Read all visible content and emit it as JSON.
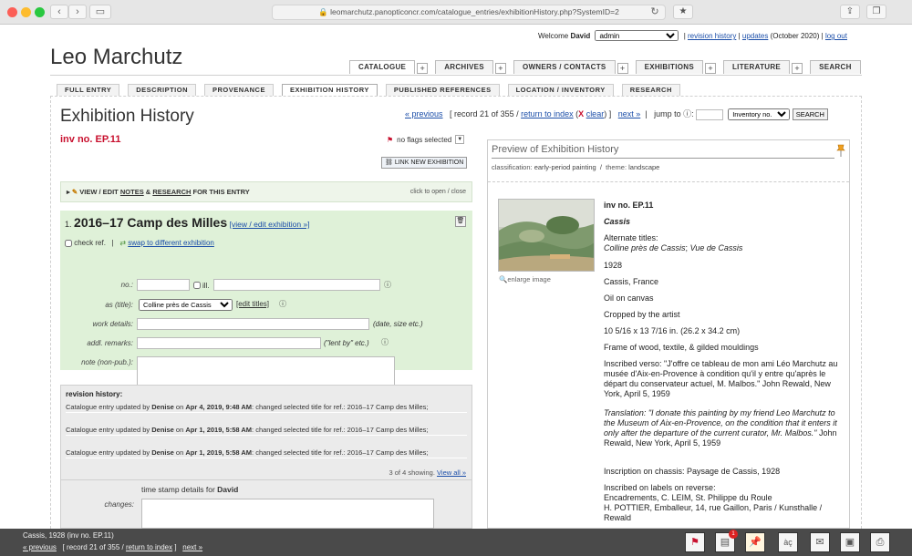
{
  "browser": {
    "url": "leomarchutz.panopticoncr.com/catalogue_entries/exhibitionHistory.php?SystemID=2"
  },
  "user": {
    "welcome_prefix": "Welcome",
    "name": "David",
    "role": "admin",
    "revision_history": "revision history",
    "updates": "updates",
    "updates_date": "(October 2020)",
    "logout": "log out"
  },
  "site_title": "Leo Marchutz",
  "top_tabs": [
    {
      "label": "CATALOGUE"
    },
    {
      "label": "ARCHIVES"
    },
    {
      "label": "OWNERS / CONTACTS"
    },
    {
      "label": "EXHIBITIONS"
    },
    {
      "label": "LITERATURE"
    },
    {
      "label": "SEARCH"
    }
  ],
  "sub_tabs": [
    {
      "label": "FULL ENTRY"
    },
    {
      "label": "DESCRIPTION"
    },
    {
      "label": "PROVENANCE"
    },
    {
      "label": "EXHIBITION HISTORY"
    },
    {
      "label": "PUBLISHED REFERENCES"
    },
    {
      "label": "LOCATION / INVENTORY"
    },
    {
      "label": "RESEARCH"
    }
  ],
  "page_heading": "Exhibition History",
  "pager": {
    "previous": "« previous",
    "record_text": "[ record 21 of 355 /",
    "return_to_index": "return to index",
    "clear_x": "X",
    "clear": "clear",
    "close_bracket": "]",
    "next": "next »",
    "jump_to": "jump to",
    "jump_select": "Inventory no.",
    "search_button": "SEARCH"
  },
  "inv_no": "inv no. EP.11",
  "flags_label": "no flags selected",
  "link_new_exhibition": "LINK NEW EXHIBITION",
  "edit_notes": {
    "prefix": "VIEW / EDIT",
    "notes": "NOTES",
    "amp": "&",
    "research": "RESEARCH",
    "suffix": "FOR THIS ENTRY",
    "toggle": "click to open / close"
  },
  "exhibition": {
    "number": "1.",
    "title": "2016–17 Camp des Milles",
    "view_edit": "[view / edit exhibition »]",
    "check_ref": "check ref.",
    "swap": "swap to different exhibition",
    "no_label": "no.:",
    "ill_label": "ill.",
    "as_title_label": "as (title):",
    "as_title_value": "Colline près de Cassis",
    "edit_titles": "[edit titles]",
    "work_details_label": "work details:",
    "work_details_hint": "(date, size etc.)",
    "addl_remarks_label": "addl. remarks:",
    "addl_remarks_hint": "(\"lent by\" etc.)",
    "note_label": "note (non-pub.):"
  },
  "revision": {
    "heading": "revision history:",
    "entries": [
      {
        "prefix": "Catalogue entry updated by ",
        "user": "Denise",
        "on": " on ",
        "date": "Apr 4, 2019, 9:48 AM",
        "text": ": changed selected title for ref.: 2016–17 Camp des Milles;"
      },
      {
        "prefix": "Catalogue entry updated by ",
        "user": "Denise",
        "on": " on ",
        "date": "Apr 1, 2019, 5:58 AM",
        "text": ": changed selected title for ref.: 2016–17 Camp des Milles;"
      },
      {
        "prefix": "Catalogue entry updated by ",
        "user": "Denise",
        "on": " on ",
        "date": "Apr 1, 2019, 5:58 AM",
        "text": ": changed selected title for ref.: 2016–17 Camp des Milles;"
      }
    ],
    "showing": "3 of 4 showing.",
    "view_all": "View all »"
  },
  "timestamp": {
    "label": "time stamp details for",
    "user": "David",
    "changes_label": "changes:"
  },
  "preview": {
    "title": "Preview of Exhibition History",
    "classification_label": "classification:",
    "classification": "early-period painting",
    "sep": "/",
    "theme_label": "theme:",
    "theme": "landscape",
    "enlarge": "enlarge image",
    "inv": "inv no. EP.11",
    "work_title": "Cassis",
    "alt_titles_label": "Alternate titles:",
    "alt_titles_1": "Colline près de Cassis",
    "alt_titles_sep": "; ",
    "alt_titles_2": "Vue de Cassis",
    "year": "1928",
    "place": "Cassis, France",
    "medium": "Oil on canvas",
    "cropped": "Cropped by the artist",
    "dimensions": "10 5/16 x 13 7/16 in. (26.2 x 34.2 cm)",
    "frame": "Frame of wood, textile, & gilded mouldings",
    "inscribed": "Inscribed verso: \"J'offre ce tableau de mon ami Léo Marchutz au musée d'Aix-en-Provence à condition qu'il y entre qu'après le départ du conservateur actuel, M. Malbos.\" John Rewald, New York, April 5, 1959",
    "translation_label": "Translation: \"I donate this painting by my friend Leo Marchutz to the Museum of Aix-en-Provence, on the condition that it enters it only after the departure of the current curator, Mr. Malbos.\"",
    "translation_tail": " John Rewald, New York, April 5, 1959",
    "chassis": "Inscription on chassis: Paysage de Cassis, 1928",
    "labels_heading": "Inscribed on labels on reverse:",
    "labels_1": "Encadrements, C. LEIM, St. Philippe du Roule",
    "labels_2": "H. POTTIER, Emballeur, 14, rue Gaillon, Paris / Kunsthalle / Rewald"
  },
  "bottom": {
    "title": "Cassis, 1928 (inv no. EP.11)",
    "previous": "« previous",
    "record": "[ record 21 of 355 /",
    "return": "return to index",
    "close": "]",
    "next": "next »",
    "badge": "1"
  }
}
